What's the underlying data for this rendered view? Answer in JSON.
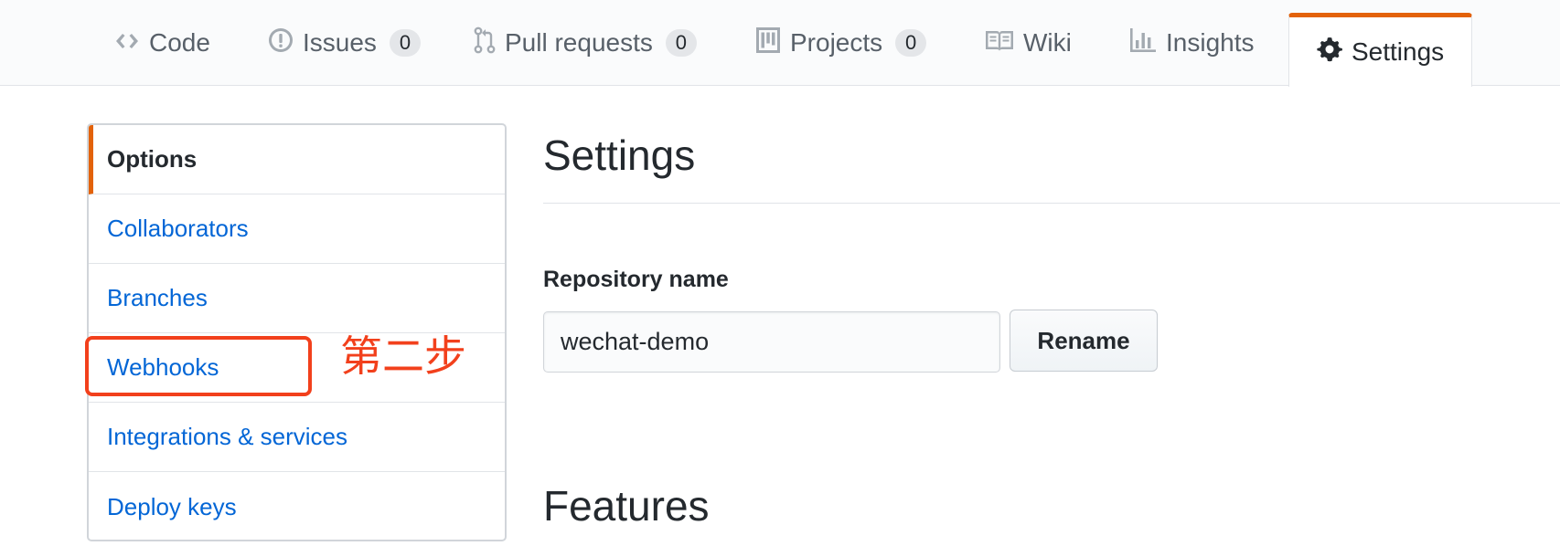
{
  "repo_nav": {
    "tabs": [
      {
        "label": "Code",
        "icon": "code-icon"
      },
      {
        "label": "Issues",
        "icon": "issue-opened-icon",
        "count": "0"
      },
      {
        "label": "Pull requests",
        "icon": "git-pull-request-icon",
        "count": "0"
      },
      {
        "label": "Projects",
        "icon": "project-icon",
        "count": "0"
      },
      {
        "label": "Wiki",
        "icon": "book-icon"
      },
      {
        "label": "Insights",
        "icon": "graph-icon"
      },
      {
        "label": "Settings",
        "icon": "gear-icon",
        "selected": true
      }
    ],
    "accent_color": "#e36209"
  },
  "sidebar": {
    "items": [
      {
        "label": "Options",
        "selected": true
      },
      {
        "label": "Collaborators"
      },
      {
        "label": "Branches"
      },
      {
        "label": "Webhooks"
      },
      {
        "label": "Integrations & services"
      },
      {
        "label": "Deploy keys"
      }
    ]
  },
  "annotation": {
    "text": "第二步",
    "color": "#f2401c"
  },
  "main": {
    "title": "Settings",
    "repository_name_label": "Repository name",
    "repository_name_value": "wechat-demo",
    "rename_label": "Rename",
    "features_title": "Features"
  }
}
